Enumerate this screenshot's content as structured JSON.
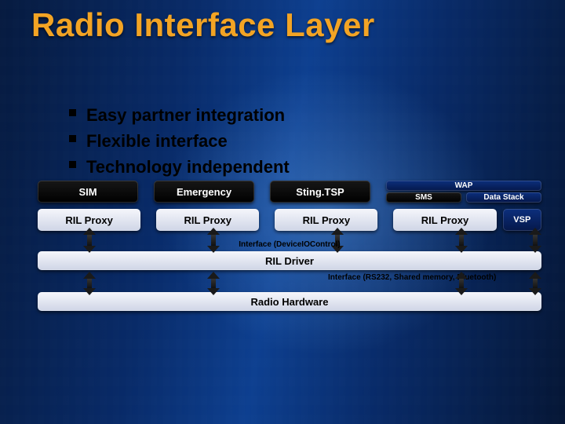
{
  "title": "Radio Interface Layer",
  "bullets": [
    "Easy partner integration",
    "Flexible interface",
    "Technology independent"
  ],
  "row1": {
    "sim": "SIM",
    "emergency": "Emergency",
    "stingtsp": "Sting.TSP",
    "wap": "WAP",
    "sms": "SMS",
    "datastack": "Data Stack"
  },
  "row2": {
    "p1": "RIL Proxy",
    "p2": "RIL Proxy",
    "p3": "RIL Proxy",
    "p4": "RIL Proxy",
    "vsp": "VSP"
  },
  "iface1": "Interface (DeviceIOControl)",
  "rildriver": "RIL Driver",
  "iface2": "Interface (RS232, Shared memory, Bluetooth)",
  "radiohw": "Radio Hardware"
}
